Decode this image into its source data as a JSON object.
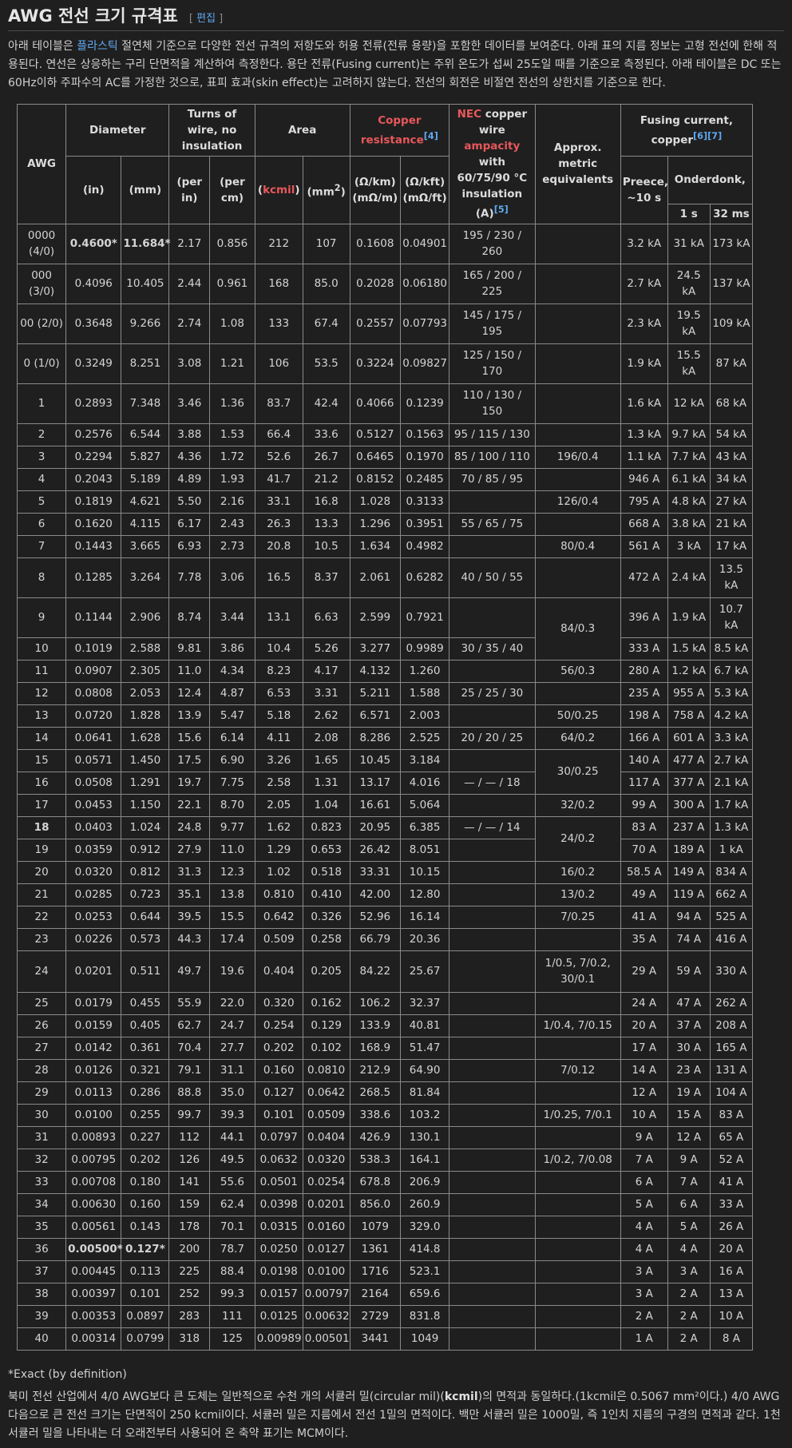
{
  "header": {
    "title": "AWG 전선 크기 규격표",
    "edit_label": "편집",
    "bracket_open": "[",
    "bracket_close": "]"
  },
  "intro": {
    "p1": "아래 테이블은 ",
    "link1": "플라스틱",
    "p2": " 절연체 기준으로 다양한 전선 규격의 저항도와 허용 전류(전류 용량)을 포함한 데이터를 보여준다. 아래 표의 지름 정보는 고형 전선에 한해 적용된다. 연선은 상응하는 구리 단면적을 계산하여 측정한다. 용단 전류(Fusing current)는 주위 온도가 섭씨 25도일 때를 기준으로 측정된다. 아래 테이블은 DC 또는 60Hz이하 주파수의 AC를 가정한 것으로, 표피 효과(skin effect)는 고려하지 않는다. 전선의 회전은 비절연 전선의 상한치를 기준으로 한다."
  },
  "table": {
    "headers": {
      "awg": "AWG",
      "diameter": "Diameter",
      "turns": "Turns of wire, no insulation",
      "area": "Area",
      "copper_res": "Copper resistance",
      "copper_res_ref": "[4]",
      "nec_a": "NEC",
      "nec_b": " copper wire ",
      "nec_c": "ampacity",
      "nec_d": " with 60/75/90 °C insulation (A)",
      "nec_ref": "[5]",
      "metric": "Approx. metric equivalents",
      "fusing": "Fusing current, copper",
      "fusing_ref": "[6][7]",
      "in": "(in)",
      "mm": "(mm)",
      "per_in": "(per in)",
      "per_cm": "(per cm)",
      "kcmil_open": "(",
      "kcmil": "kcmil",
      "kcmil_close": ")",
      "mm2": "(mm",
      "mm2_sup": "2",
      "mm2_close": ")",
      "ohm_km": "(Ω/km) (mΩ/m)",
      "ohm_kft": "(Ω/kft) (mΩ/ft)",
      "preece": "Preece, ~10 s",
      "onderdonk": "Onderdonk,",
      "s1": "1 s",
      "ms32": "32 ms"
    },
    "rows": [
      [
        "0000 (4/0)",
        "0.4600*",
        "11.684*",
        "2.17",
        "0.856",
        "212",
        "107",
        "0.1608",
        "0.04901",
        "195 / 230 / 260",
        "",
        "3.2 kA",
        "31 kA",
        "173 kA"
      ],
      [
        "000 (3/0)",
        "0.4096",
        "10.405",
        "2.44",
        "0.961",
        "168",
        "85.0",
        "0.2028",
        "0.06180",
        "165 / 200 / 225",
        "",
        "2.7 kA",
        "24.5 kA",
        "137 kA"
      ],
      [
        "00 (2/0)",
        "0.3648",
        "9.266",
        "2.74",
        "1.08",
        "133",
        "67.4",
        "0.2557",
        "0.07793",
        "145 / 175 / 195",
        "",
        "2.3 kA",
        "19.5 kA",
        "109 kA"
      ],
      [
        "0 (1/0)",
        "0.3249",
        "8.251",
        "3.08",
        "1.21",
        "106",
        "53.5",
        "0.3224",
        "0.09827",
        "125 / 150 / 170",
        "",
        "1.9 kA",
        "15.5 kA",
        "87 kA"
      ],
      [
        "1",
        "0.2893",
        "7.348",
        "3.46",
        "1.36",
        "83.7",
        "42.4",
        "0.4066",
        "0.1239",
        "110 / 130 / 150",
        "",
        "1.6 kA",
        "12 kA",
        "68 kA"
      ],
      [
        "2",
        "0.2576",
        "6.544",
        "3.88",
        "1.53",
        "66.4",
        "33.6",
        "0.5127",
        "0.1563",
        "95 / 115 / 130",
        "",
        "1.3 kA",
        "9.7 kA",
        "54 kA"
      ],
      [
        "3",
        "0.2294",
        "5.827",
        "4.36",
        "1.72",
        "52.6",
        "26.7",
        "0.6465",
        "0.1970",
        "85 / 100 / 110",
        "196/0.4",
        "1.1 kA",
        "7.7 kA",
        "43 kA"
      ],
      [
        "4",
        "0.2043",
        "5.189",
        "4.89",
        "1.93",
        "41.7",
        "21.2",
        "0.8152",
        "0.2485",
        "70 / 85 / 95",
        "",
        "946 A",
        "6.1 kA",
        "34 kA"
      ],
      [
        "5",
        "0.1819",
        "4.621",
        "5.50",
        "2.16",
        "33.1",
        "16.8",
        "1.028",
        "0.3133",
        "",
        "126/0.4",
        "795 A",
        "4.8 kA",
        "27 kA"
      ],
      [
        "6",
        "0.1620",
        "4.115",
        "6.17",
        "2.43",
        "26.3",
        "13.3",
        "1.296",
        "0.3951",
        "55 / 65 / 75",
        "",
        "668 A",
        "3.8 kA",
        "21 kA"
      ],
      [
        "7",
        "0.1443",
        "3.665",
        "6.93",
        "2.73",
        "20.8",
        "10.5",
        "1.634",
        "0.4982",
        "",
        "80/0.4",
        "561 A",
        "3 kA",
        "17 kA"
      ],
      [
        "8",
        "0.1285",
        "3.264",
        "7.78",
        "3.06",
        "16.5",
        "8.37",
        "2.061",
        "0.6282",
        "40 / 50 / 55",
        "",
        "472 A",
        "2.4 kA",
        "13.5 kA"
      ],
      [
        "9",
        "0.1144",
        "2.906",
        "8.74",
        "3.44",
        "13.1",
        "6.63",
        "2.599",
        "0.7921",
        "",
        "84/0.3",
        "396 A",
        "1.9 kA",
        "10.7 kA"
      ],
      [
        "10",
        "0.1019",
        "2.588",
        "9.81",
        "3.86",
        "10.4",
        "5.26",
        "3.277",
        "0.9989",
        "30 / 35 / 40",
        "",
        "333 A",
        "1.5 kA",
        "8.5 kA"
      ],
      [
        "11",
        "0.0907",
        "2.305",
        "11.0",
        "4.34",
        "8.23",
        "4.17",
        "4.132",
        "1.260",
        "",
        "56/0.3",
        "280 A",
        "1.2 kA",
        "6.7 kA"
      ],
      [
        "12",
        "0.0808",
        "2.053",
        "12.4",
        "4.87",
        "6.53",
        "3.31",
        "5.211",
        "1.588",
        "25 / 25 / 30",
        "",
        "235 A",
        "955 A",
        "5.3 kA"
      ],
      [
        "13",
        "0.0720",
        "1.828",
        "13.9",
        "5.47",
        "5.18",
        "2.62",
        "6.571",
        "2.003",
        "",
        "50/0.25",
        "198 A",
        "758 A",
        "4.2 kA"
      ],
      [
        "14",
        "0.0641",
        "1.628",
        "15.6",
        "6.14",
        "4.11",
        "2.08",
        "8.286",
        "2.525",
        "20 / 20 / 25",
        "64/0.2",
        "166 A",
        "601 A",
        "3.3 kA"
      ],
      [
        "15",
        "0.0571",
        "1.450",
        "17.5",
        "6.90",
        "3.26",
        "1.65",
        "10.45",
        "3.184",
        "",
        "30/0.25",
        "140 A",
        "477 A",
        "2.7 kA"
      ],
      [
        "16",
        "0.0508",
        "1.291",
        "19.7",
        "7.75",
        "2.58",
        "1.31",
        "13.17",
        "4.016",
        "— / — / 18",
        "",
        "117 A",
        "377 A",
        "2.1 kA"
      ],
      [
        "17",
        "0.0453",
        "1.150",
        "22.1",
        "8.70",
        "2.05",
        "1.04",
        "16.61",
        "5.064",
        "",
        "32/0.2",
        "99 A",
        "300 A",
        "1.7 kA"
      ],
      [
        "18",
        "0.0403",
        "1.024",
        "24.8",
        "9.77",
        "1.62",
        "0.823",
        "20.95",
        "6.385",
        "— / — / 14",
        "24/0.2",
        "83 A",
        "237 A",
        "1.3 kA"
      ],
      [
        "19",
        "0.0359",
        "0.912",
        "27.9",
        "11.0",
        "1.29",
        "0.653",
        "26.42",
        "8.051",
        "",
        "",
        "70 A",
        "189 A",
        "1 kA"
      ],
      [
        "20",
        "0.0320",
        "0.812",
        "31.3",
        "12.3",
        "1.02",
        "0.518",
        "33.31",
        "10.15",
        "",
        "16/0.2",
        "58.5 A",
        "149 A",
        "834 A"
      ],
      [
        "21",
        "0.0285",
        "0.723",
        "35.1",
        "13.8",
        "0.810",
        "0.410",
        "42.00",
        "12.80",
        "",
        "13/0.2",
        "49 A",
        "119 A",
        "662 A"
      ],
      [
        "22",
        "0.0253",
        "0.644",
        "39.5",
        "15.5",
        "0.642",
        "0.326",
        "52.96",
        "16.14",
        "",
        "7/0.25",
        "41 A",
        "94 A",
        "525 A"
      ],
      [
        "23",
        "0.0226",
        "0.573",
        "44.3",
        "17.4",
        "0.509",
        "0.258",
        "66.79",
        "20.36",
        "",
        "",
        "35 A",
        "74 A",
        "416 A"
      ],
      [
        "24",
        "0.0201",
        "0.511",
        "49.7",
        "19.6",
        "0.404",
        "0.205",
        "84.22",
        "25.67",
        "",
        "1/0.5, 7/0.2, 30/0.1",
        "29 A",
        "59 A",
        "330 A"
      ],
      [
        "25",
        "0.0179",
        "0.455",
        "55.9",
        "22.0",
        "0.320",
        "0.162",
        "106.2",
        "32.37",
        "",
        "",
        "24 A",
        "47 A",
        "262 A"
      ],
      [
        "26",
        "0.0159",
        "0.405",
        "62.7",
        "24.7",
        "0.254",
        "0.129",
        "133.9",
        "40.81",
        "",
        "1/0.4, 7/0.15",
        "20 A",
        "37 A",
        "208 A"
      ],
      [
        "27",
        "0.0142",
        "0.361",
        "70.4",
        "27.7",
        "0.202",
        "0.102",
        "168.9",
        "51.47",
        "",
        "",
        "17 A",
        "30 A",
        "165 A"
      ],
      [
        "28",
        "0.0126",
        "0.321",
        "79.1",
        "31.1",
        "0.160",
        "0.0810",
        "212.9",
        "64.90",
        "",
        "7/0.12",
        "14 A",
        "23 A",
        "131 A"
      ],
      [
        "29",
        "0.0113",
        "0.286",
        "88.8",
        "35.0",
        "0.127",
        "0.0642",
        "268.5",
        "81.84",
        "",
        "",
        "12 A",
        "19 A",
        "104 A"
      ],
      [
        "30",
        "0.0100",
        "0.255",
        "99.7",
        "39.3",
        "0.101",
        "0.0509",
        "338.6",
        "103.2",
        "",
        "1/0.25, 7/0.1",
        "10 A",
        "15 A",
        "83 A"
      ],
      [
        "31",
        "0.00893",
        "0.227",
        "112",
        "44.1",
        "0.0797",
        "0.0404",
        "426.9",
        "130.1",
        "",
        "",
        "9 A",
        "12 A",
        "65 A"
      ],
      [
        "32",
        "0.00795",
        "0.202",
        "126",
        "49.5",
        "0.0632",
        "0.0320",
        "538.3",
        "164.1",
        "",
        "1/0.2, 7/0.08",
        "7 A",
        "9 A",
        "52 A"
      ],
      [
        "33",
        "0.00708",
        "0.180",
        "141",
        "55.6",
        "0.0501",
        "0.0254",
        "678.8",
        "206.9",
        "",
        "",
        "6 A",
        "7 A",
        "41 A"
      ],
      [
        "34",
        "0.00630",
        "0.160",
        "159",
        "62.4",
        "0.0398",
        "0.0201",
        "856.0",
        "260.9",
        "",
        "",
        "5 A",
        "6 A",
        "33 A"
      ],
      [
        "35",
        "0.00561",
        "0.143",
        "178",
        "70.1",
        "0.0315",
        "0.0160",
        "1079",
        "329.0",
        "",
        "",
        "4 A",
        "5 A",
        "26 A"
      ],
      [
        "36",
        "0.00500*",
        "0.127*",
        "200",
        "78.7",
        "0.0250",
        "0.0127",
        "1361",
        "414.8",
        "",
        "",
        "4 A",
        "4 A",
        "20 A"
      ],
      [
        "37",
        "0.00445",
        "0.113",
        "225",
        "88.4",
        "0.0198",
        "0.0100",
        "1716",
        "523.1",
        "",
        "",
        "3 A",
        "3 A",
        "16 A"
      ],
      [
        "38",
        "0.00397",
        "0.101",
        "252",
        "99.3",
        "0.0157",
        "0.00797",
        "2164",
        "659.6",
        "",
        "",
        "3 A",
        "2 A",
        "13 A"
      ],
      [
        "39",
        "0.00353",
        "0.0897",
        "283",
        "111",
        "0.0125",
        "0.00632",
        "2729",
        "831.8",
        "",
        "",
        "2 A",
        "2 A",
        "10 A"
      ],
      [
        "40",
        "0.00314",
        "0.0799",
        "318",
        "125",
        "0.00989",
        "0.00501",
        "3441",
        "1049",
        "",
        "",
        "1 A",
        "2 A",
        "8 A"
      ]
    ]
  },
  "footnote": "*Exact (by definition)",
  "footer": {
    "t1": "북미 전선 산업에서 4/0 AWG보다 큰 도체는 일반적으로 수천 개의 서큘러 밀(circular mil)(",
    "kcmil": "kcmil",
    "t2": ")의 면적과 동일하다.(1kcmil은 0.5067 mm²이다.) 4/0 AWG 다음으로 큰 전선 크기는 단면적이 250 kcmil이다. 서큘러 밀은 지름에서 전선 1밀의 면적이다. 백만 서큘러 밀은 1000밀, 즉 1인치 지름의 구경의 면적과 같다. 1천 서큘러 밀을 나타내는 더 오래전부터 사용되어 온 축약 표기는 MCM이다."
  }
}
